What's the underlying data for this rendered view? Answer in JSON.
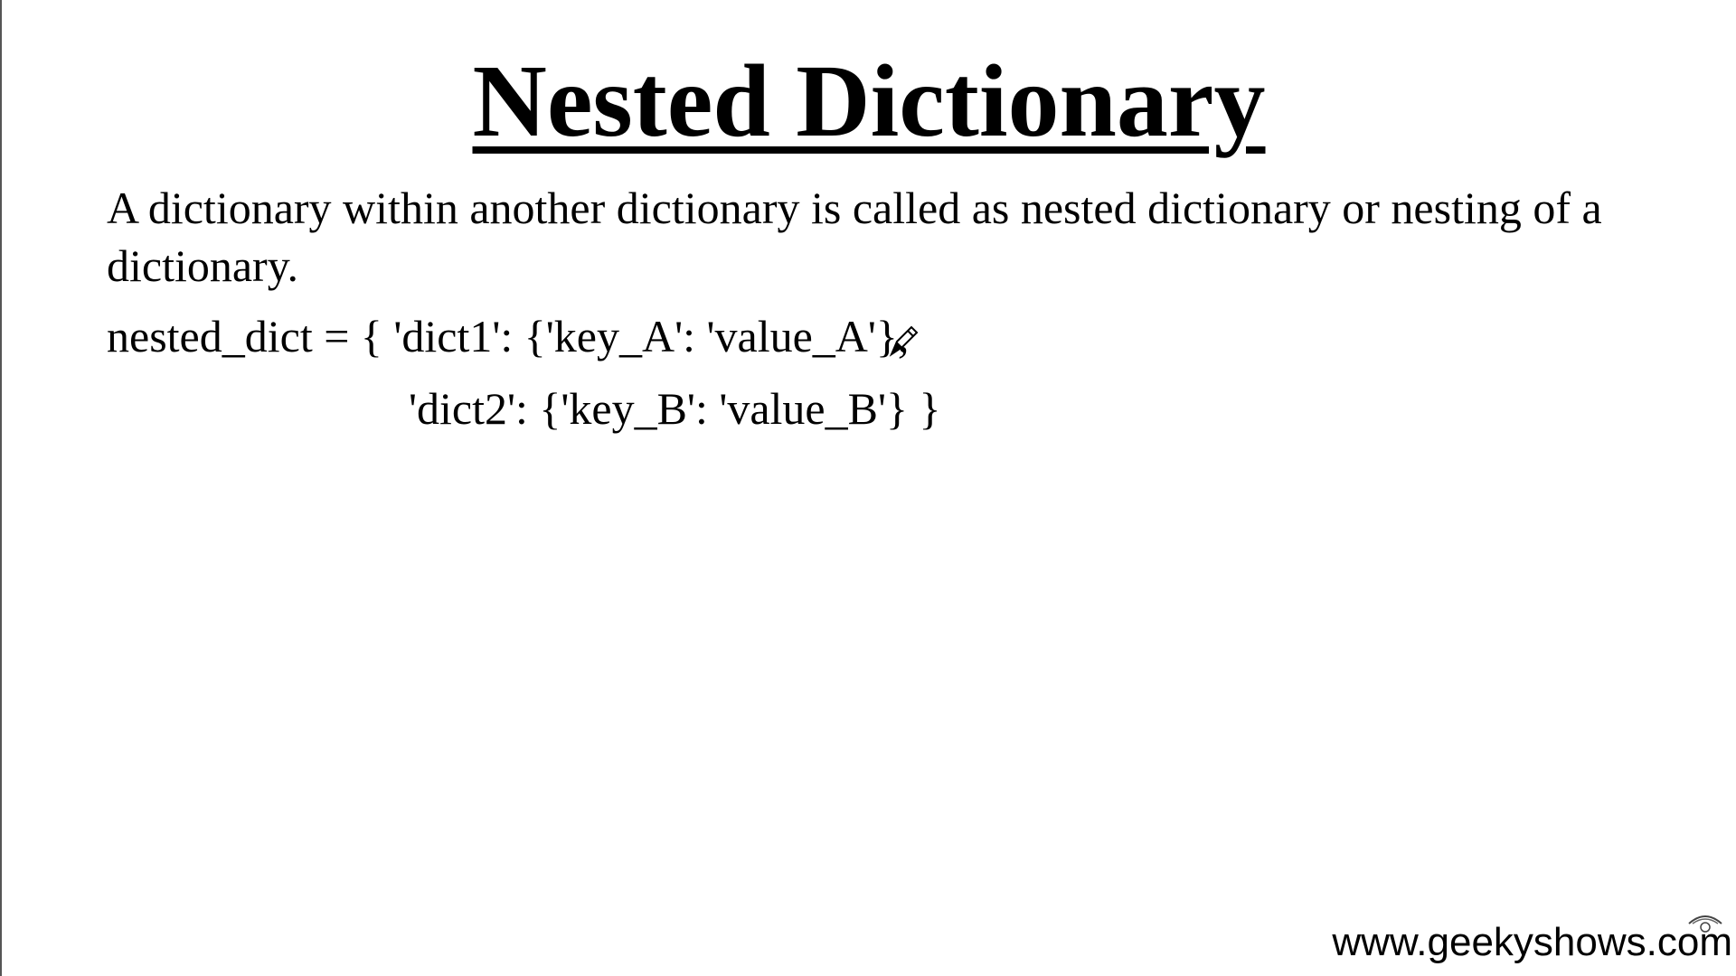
{
  "slide": {
    "title": "Nested Dictionary",
    "description": "A dictionary within another dictionary is called as nested dictionary or nesting of a dictionary.",
    "code_lines": [
      "nested_dict = { 'dict1': {'key_A': 'value_A'},",
      "'dict2': {'key_B': 'value_B'} }"
    ],
    "watermark": "www.geekyshows.com"
  },
  "icons": {
    "cursor": "pen-cursor-icon",
    "watermark_logo": "eye-logo-icon"
  },
  "colors": {
    "background": "#ffffff",
    "text": "#000000"
  }
}
